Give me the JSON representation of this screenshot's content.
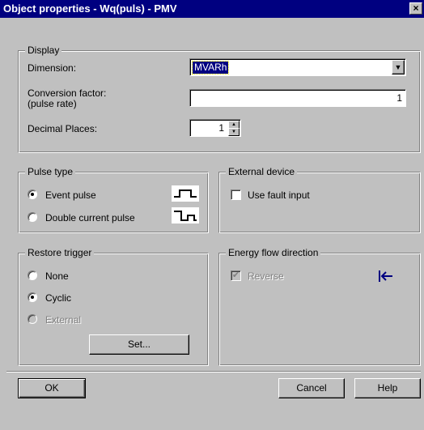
{
  "window": {
    "title": "Object properties - Wq(puls) - PMV",
    "close_glyph": "×"
  },
  "display": {
    "legend": "Display",
    "dimension_label": "Dimension:",
    "dimension_value": "MVARh",
    "conversion_label_1": "Conversion factor:",
    "conversion_label_2": "(pulse rate)",
    "conversion_value": "1",
    "decimal_label": "Decimal Places:",
    "decimal_value": "1"
  },
  "pulse_type": {
    "legend": "Pulse type",
    "options": [
      {
        "label": "Event pulse",
        "checked": true,
        "icon": "event-pulse-waveform-icon"
      },
      {
        "label": "Double current pulse",
        "checked": false,
        "icon": "double-current-pulse-waveform-icon"
      }
    ]
  },
  "external_device": {
    "legend": "External device",
    "use_fault_input_label": "Use fault input",
    "use_fault_input_checked": false
  },
  "restore_trigger": {
    "legend": "Restore trigger",
    "options": [
      {
        "label": "None",
        "checked": false,
        "disabled": false
      },
      {
        "label": "Cyclic",
        "checked": true,
        "disabled": false
      },
      {
        "label": "External",
        "checked": false,
        "disabled": true
      }
    ],
    "set_button": "Set..."
  },
  "energy_flow": {
    "legend": "Energy flow direction",
    "reverse_label": "Reverse",
    "reverse_checked": true,
    "reverse_disabled": true,
    "icon": "arrow-left-bar-icon",
    "icon_color": "#000080"
  },
  "buttons": {
    "ok": "OK",
    "cancel": "Cancel",
    "help": "Help"
  },
  "colors": {
    "titlebar": "#000080",
    "face": "#c0c0c0",
    "selection": "#000080"
  }
}
